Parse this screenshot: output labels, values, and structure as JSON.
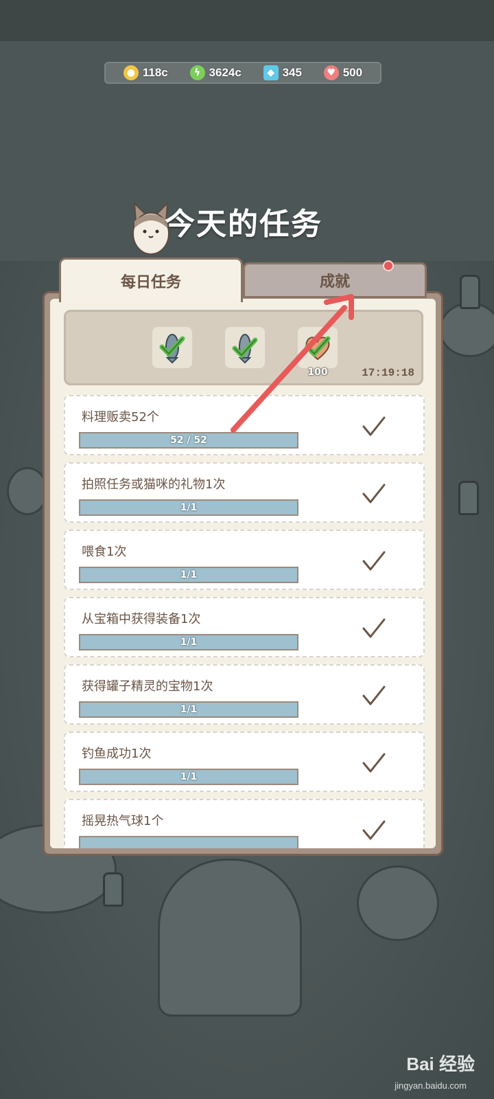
{
  "currency": [
    {
      "icon": "coin-icon",
      "value": "118c",
      "color": "#f2c544"
    },
    {
      "icon": "lightning-icon",
      "value": "3624c",
      "color": "#7ccf5a"
    },
    {
      "icon": "gem-icon",
      "value": "345",
      "color": "#5fc9e8"
    },
    {
      "icon": "heart-icon",
      "value": "500",
      "color": "#ef7f7f"
    }
  ],
  "title": "今天的任务",
  "tabs": {
    "daily": "每日任务",
    "achievements": "成就"
  },
  "rewards": {
    "items": [
      {
        "icon": "fish-reward-icon",
        "claimed": true
      },
      {
        "icon": "fish-reward-icon",
        "claimed": true
      },
      {
        "icon": "heart-reward-icon",
        "claimed": true,
        "count": "100"
      }
    ],
    "timer": "17:19:18"
  },
  "tasks": [
    {
      "label": "料理贩卖52个",
      "progress": "52 / 52",
      "fraction": 1.0,
      "done": true
    },
    {
      "label": "拍照任务或猫咪的礼物1次",
      "progress": "1/1",
      "fraction": 1.0,
      "done": true
    },
    {
      "label": "喂食1次",
      "progress": "1/1",
      "fraction": 1.0,
      "done": true
    },
    {
      "label": "从宝箱中获得装备1次",
      "progress": "1/1",
      "fraction": 1.0,
      "done": true
    },
    {
      "label": "获得罐子精灵的宝物1次",
      "progress": "1/1",
      "fraction": 1.0,
      "done": true
    },
    {
      "label": "钓鱼成功1次",
      "progress": "1/1",
      "fraction": 1.0,
      "done": true
    },
    {
      "label": "摇晃热气球1个",
      "progress": "",
      "fraction": 1.0,
      "done": true
    }
  ],
  "colors": {
    "check": "#6a5546",
    "arrow": "#e85a5a",
    "progress_fill": "#9ec0cf"
  },
  "watermark": {
    "main": "Bai 经验",
    "sub": "jingyan.baidu.com"
  }
}
